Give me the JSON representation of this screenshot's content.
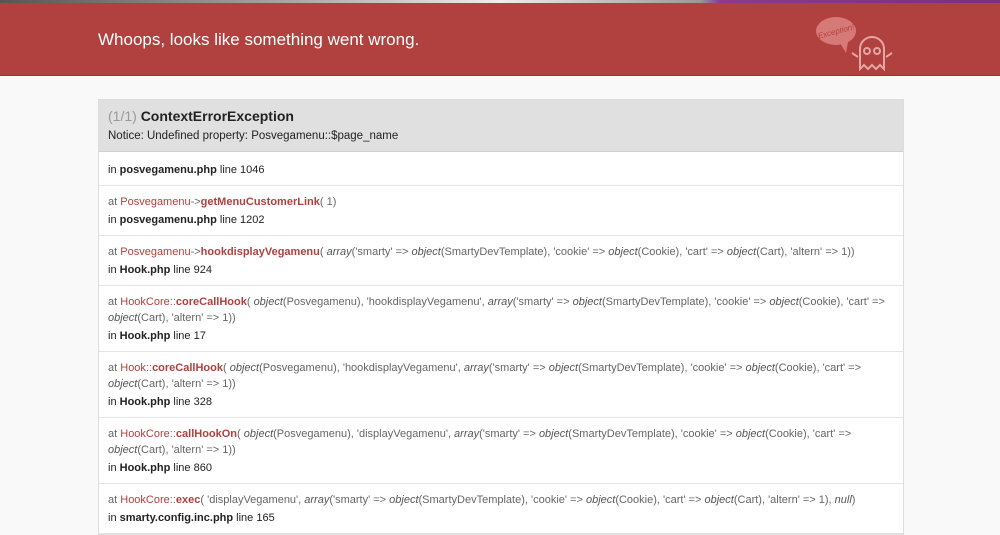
{
  "header": {
    "title": "Whoops, looks like something went wrong.",
    "logo_text": "Exception!"
  },
  "exception": {
    "count": "(1/1)",
    "name": "ContextErrorException",
    "message": "Notice: Undefined property: Posvegamenu::$page_name"
  },
  "trace": [
    {
      "at": null,
      "file": "posvegamenu.php",
      "line": "line 1046"
    },
    {
      "at": "at",
      "cls": "Posvegamenu",
      "sep": "->",
      "fn": "getMenuCustomerLink",
      "args": [
        {
          "t": "( 1)"
        }
      ],
      "in": "in",
      "file": "posvegamenu.php",
      "line": "line 1202"
    },
    {
      "at": "at",
      "cls": "Posvegamenu",
      "sep": "->",
      "fn": "hookdisplayVegamenu",
      "args": [
        {
          "t": "( "
        },
        {
          "t": "array",
          "i": true
        },
        {
          "t": "('smarty' => "
        },
        {
          "t": "object",
          "i": true
        },
        {
          "t": "(SmartyDevTemplate), 'cookie' => "
        },
        {
          "t": "object",
          "i": true
        },
        {
          "t": "(Cookie), 'cart' => "
        },
        {
          "t": "object",
          "i": true
        },
        {
          "t": "(Cart), 'altern' => 1))"
        }
      ],
      "in": "in",
      "file": "Hook.php",
      "line": "line 924"
    },
    {
      "at": "at",
      "cls": "HookCore",
      "sep": "::",
      "fn": "coreCallHook",
      "args": [
        {
          "t": "( "
        },
        {
          "t": "object",
          "i": true
        },
        {
          "t": "(Posvegamenu), 'hookdisplayVegamenu', "
        },
        {
          "t": "array",
          "i": true
        },
        {
          "t": "('smarty' => "
        },
        {
          "t": "object",
          "i": true
        },
        {
          "t": "(SmartyDevTemplate), 'cookie' => "
        },
        {
          "t": "object",
          "i": true
        },
        {
          "t": "(Cookie), 'cart' => "
        },
        {
          "t": "object",
          "i": true
        },
        {
          "t": "(Cart), 'altern' => 1))"
        }
      ],
      "in": "in",
      "file": "Hook.php",
      "line": "line 17"
    },
    {
      "at": "at",
      "cls": "Hook",
      "sep": "::",
      "fn": "coreCallHook",
      "args": [
        {
          "t": "( "
        },
        {
          "t": "object",
          "i": true
        },
        {
          "t": "(Posvegamenu), 'hookdisplayVegamenu', "
        },
        {
          "t": "array",
          "i": true
        },
        {
          "t": "('smarty' => "
        },
        {
          "t": "object",
          "i": true
        },
        {
          "t": "(SmartyDevTemplate), 'cookie' => "
        },
        {
          "t": "object",
          "i": true
        },
        {
          "t": "(Cookie), 'cart' => "
        },
        {
          "t": "object",
          "i": true
        },
        {
          "t": "(Cart), 'altern' => 1))"
        }
      ],
      "in": "in",
      "file": "Hook.php",
      "line": "line 328"
    },
    {
      "at": "at",
      "cls": "HookCore",
      "sep": "::",
      "fn": "callHookOn",
      "args": [
        {
          "t": "( "
        },
        {
          "t": "object",
          "i": true
        },
        {
          "t": "(Posvegamenu), 'displayVegamenu', "
        },
        {
          "t": "array",
          "i": true
        },
        {
          "t": "('smarty' => "
        },
        {
          "t": "object",
          "i": true
        },
        {
          "t": "(SmartyDevTemplate), 'cookie' => "
        },
        {
          "t": "object",
          "i": true
        },
        {
          "t": "(Cookie), 'cart' => "
        },
        {
          "t": "object",
          "i": true
        },
        {
          "t": "(Cart), 'altern' => 1))"
        }
      ],
      "in": "in",
      "file": "Hook.php",
      "line": "line 860"
    },
    {
      "at": "at",
      "cls": "HookCore",
      "sep": "::",
      "fn": "exec",
      "args": [
        {
          "t": "( 'displayVegamenu', "
        },
        {
          "t": "array",
          "i": true
        },
        {
          "t": "('smarty' => "
        },
        {
          "t": "object",
          "i": true
        },
        {
          "t": "(SmartyDevTemplate), 'cookie' => "
        },
        {
          "t": "object",
          "i": true
        },
        {
          "t": "(Cookie), 'cart' => "
        },
        {
          "t": "object",
          "i": true
        },
        {
          "t": "(Cart), 'altern' => 1), "
        },
        {
          "t": "null",
          "i": true
        },
        {
          "t": ")"
        }
      ],
      "in": "in",
      "file": "smarty.config.inc.php",
      "line": "line 165"
    }
  ]
}
